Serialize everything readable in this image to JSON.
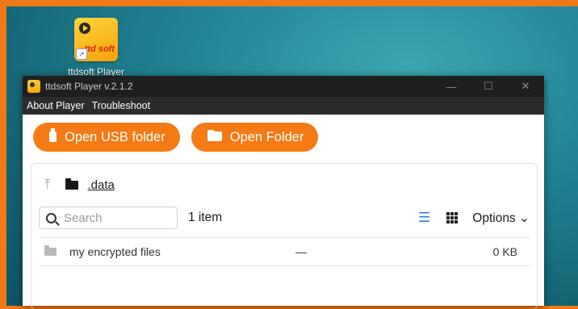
{
  "desktop": {
    "icon_label": "ttdsoft Player",
    "icon_logo_text": "ttd soft"
  },
  "window": {
    "title": "ttdsoft Player v.2.1.2",
    "controls": {
      "minimize": "—",
      "maximize": "☐",
      "close": "✕"
    },
    "menu": [
      "About Player",
      "Troubleshoot"
    ]
  },
  "toolbar": {
    "open_usb_label": "Open USB folder",
    "open_folder_label": "Open Folder"
  },
  "browser": {
    "path": ".data",
    "search_placeholder": "Search",
    "item_count": "1 item",
    "options_label": "Options",
    "rows": [
      {
        "name": "my encrypted files",
        "date": "—",
        "size": "0 KB"
      }
    ]
  },
  "colors": {
    "accent": "#f47a14",
    "titlebar": "#1f1f1f",
    "list_view_icon": "#2f7fe0"
  }
}
